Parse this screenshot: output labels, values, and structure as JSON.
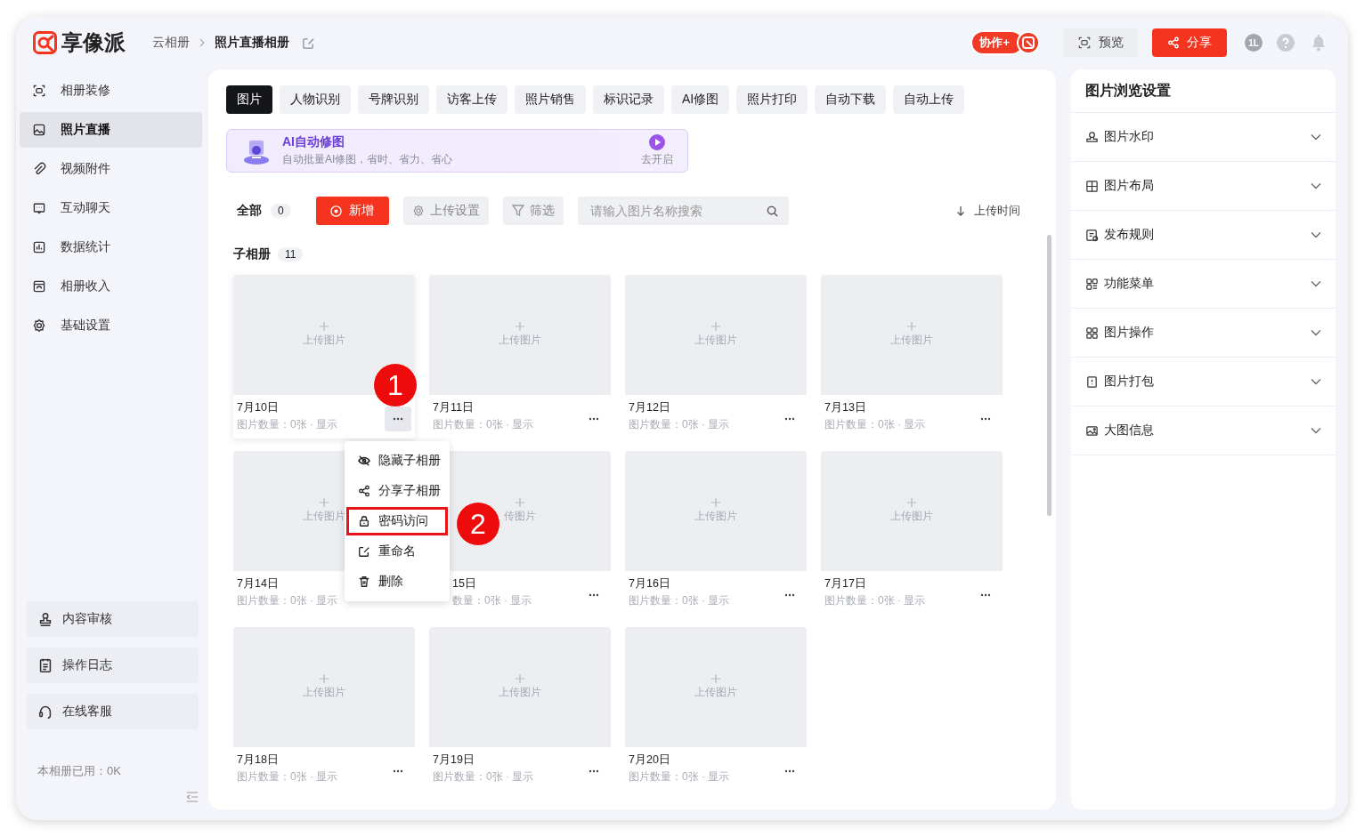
{
  "header": {
    "logo": "享像派",
    "breadcrumb": [
      "云相册",
      "照片直播相册"
    ],
    "collab": "协作+",
    "preview": "预览",
    "share": "分享",
    "avatar": "1L"
  },
  "sidebar": {
    "items": [
      {
        "label": "相册装修",
        "selected": false
      },
      {
        "label": "照片直播",
        "selected": true
      },
      {
        "label": "视频附件",
        "selected": false
      },
      {
        "label": "互动聊天",
        "selected": false
      },
      {
        "label": "数据统计",
        "selected": false
      },
      {
        "label": "相册收入",
        "selected": false
      },
      {
        "label": "基础设置",
        "selected": false
      }
    ],
    "bottom_items": [
      "内容审核",
      "操作日志",
      "在线客服"
    ],
    "usage": "本相册已用：0K"
  },
  "tabs": [
    {
      "label": "图片",
      "selected": true
    },
    {
      "label": "人物识别",
      "selected": false
    },
    {
      "label": "号牌识别",
      "selected": false
    },
    {
      "label": "访客上传",
      "selected": false
    },
    {
      "label": "照片销售",
      "selected": false
    },
    {
      "label": "标识记录",
      "selected": false
    },
    {
      "label": "AI修图",
      "selected": false
    },
    {
      "label": "照片打印",
      "selected": false
    },
    {
      "label": "自动下载",
      "selected": false
    },
    {
      "label": "自动上传",
      "selected": false
    }
  ],
  "banner": {
    "title": "AI自动修图",
    "subtitle": "自动批量AI修图，省时、省力、省心",
    "action": "去开启"
  },
  "toolbar": {
    "all": "全部",
    "all_count": "0",
    "add": "新增",
    "upload_settings": "上传设置",
    "filter": "筛选",
    "search": {
      "placeholder": "请输入图片名称搜索"
    },
    "sort": "上传时间"
  },
  "sub_albums": {
    "title": "子相册",
    "count": "11",
    "cards": [
      {
        "kind": "plain",
        "placeholder": "上传图片",
        "date": "7月10日",
        "meta": "图片数量：0张 · 显示",
        "active": true
      },
      {
        "kind": "plain",
        "placeholder": "上传图片",
        "date": "7月11日",
        "meta": "图片数量：0张 · 显示",
        "active": false
      },
      {
        "kind": "plain",
        "placeholder": "上传图片",
        "date": "7月12日",
        "meta": "图片数量：0张 · 显示",
        "active": false
      },
      {
        "kind": "plain",
        "placeholder": "上传图片",
        "date": "7月13日",
        "meta": "图片数量：0张 · 显示",
        "active": false
      },
      {
        "kind": "under-menu",
        "placeholder": "上传图片",
        "date": "7月14日",
        "meta": "图片数量：0张 · 显示",
        "active": false
      },
      {
        "kind": "covered",
        "placeholder": "传图片",
        "date": "15日",
        "meta": "数量：0张 · 显示",
        "active": false
      },
      {
        "kind": "plain",
        "placeholder": "上传图片",
        "date": "7月16日",
        "meta": "图片数量：0张 · 显示",
        "active": false
      },
      {
        "kind": "plain",
        "placeholder": "上传图片",
        "date": "7月17日",
        "meta": "图片数量：0张 · 显示",
        "active": false
      },
      {
        "kind": "plain",
        "placeholder": "上传图片",
        "date": "7月18日",
        "meta": "图片数量：0张 · 显示",
        "active": false
      },
      {
        "kind": "plain",
        "placeholder": "上传图片",
        "date": "7月19日",
        "meta": "图片数量：0张 · 显示",
        "active": false
      },
      {
        "kind": "plain",
        "placeholder": "上传图片",
        "date": "7月20日",
        "meta": "图片数量：0张 · 显示",
        "active": false
      }
    ]
  },
  "context_menu": [
    {
      "label": "隐藏子相册",
      "highlighted": false
    },
    {
      "label": "分享子相册",
      "highlighted": false
    },
    {
      "label": "密码访问",
      "highlighted": true
    },
    {
      "label": "重命名",
      "highlighted": false
    },
    {
      "label": "删除",
      "highlighted": false
    }
  ],
  "annotations": [
    "1",
    "2"
  ],
  "settings": {
    "title": "图片浏览设置",
    "items": [
      {
        "label": "图片水印",
        "expanded": false
      },
      {
        "label": "图片布局",
        "expanded": false
      },
      {
        "label": "发布规则",
        "expanded": false
      },
      {
        "label": "功能菜单",
        "expanded": false
      },
      {
        "label": "图片操作",
        "expanded": false
      },
      {
        "label": "图片打包",
        "expanded": false
      },
      {
        "label": "大图信息",
        "expanded": false
      }
    ]
  }
}
